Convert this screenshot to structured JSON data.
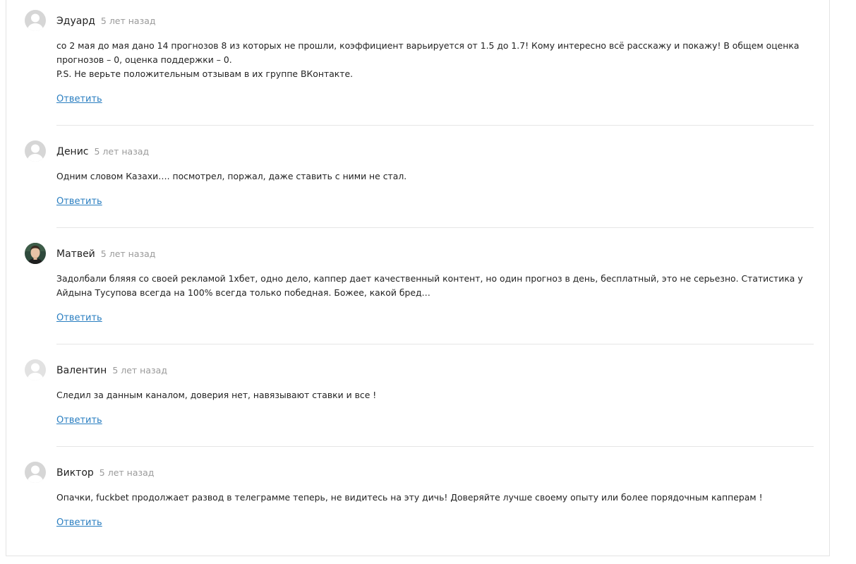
{
  "comments": [
    {
      "author": "Эдуард",
      "date": "5 лет назад",
      "lines": [
        "со 2 мая до мая дано 14 прогнозов 8 из которых не прошли, коэффициент варьируется от 1.5 до 1.7! Кому интересно всё расскажу и покажу! В общем оценка",
        "прогнозов – 0, оценка поддержки – 0.",
        "P.S. Не верьте положительным отзывам в их группе ВКонтакте."
      ],
      "reply": "Ответить",
      "avatar": "default-avatar"
    },
    {
      "author": "Денис",
      "date": "5 лет назад",
      "lines": [
        "Одним словом Казахи…. посмотрел, поржал, даже ставить с ними не стал."
      ],
      "reply": "Ответить",
      "avatar": "default-avatar"
    },
    {
      "author": "Матвей",
      "date": "5 лет назад",
      "lines": [
        "Задолбали бляяя со своей рекламой 1хбет, одно дело, каппер дает качественный контент, но один прогноз в день, бесплатный, это не серьезно. Статистика у",
        "Айдына Тусупова всегда на 100% всегда только победная. Божее, какой бред…"
      ],
      "reply": "Ответить",
      "avatar": "photo-avatar"
    },
    {
      "author": "Валентин",
      "date": "5 лет назад",
      "lines": [
        "Следил за данным каналом, доверия нет, навязывают ставки и все !"
      ],
      "reply": "Ответить",
      "avatar": "default-avatar"
    },
    {
      "author": "Виктор",
      "date": "5 лет назад",
      "lines": [
        "Опачки, fuckbet продолжает развод в телеграмме теперь, не видитесь на эту дичь! Доверяйте лучше своему опыту или более порядочным капперам !"
      ],
      "reply": "Ответить",
      "avatar": "default-avatar"
    }
  ]
}
